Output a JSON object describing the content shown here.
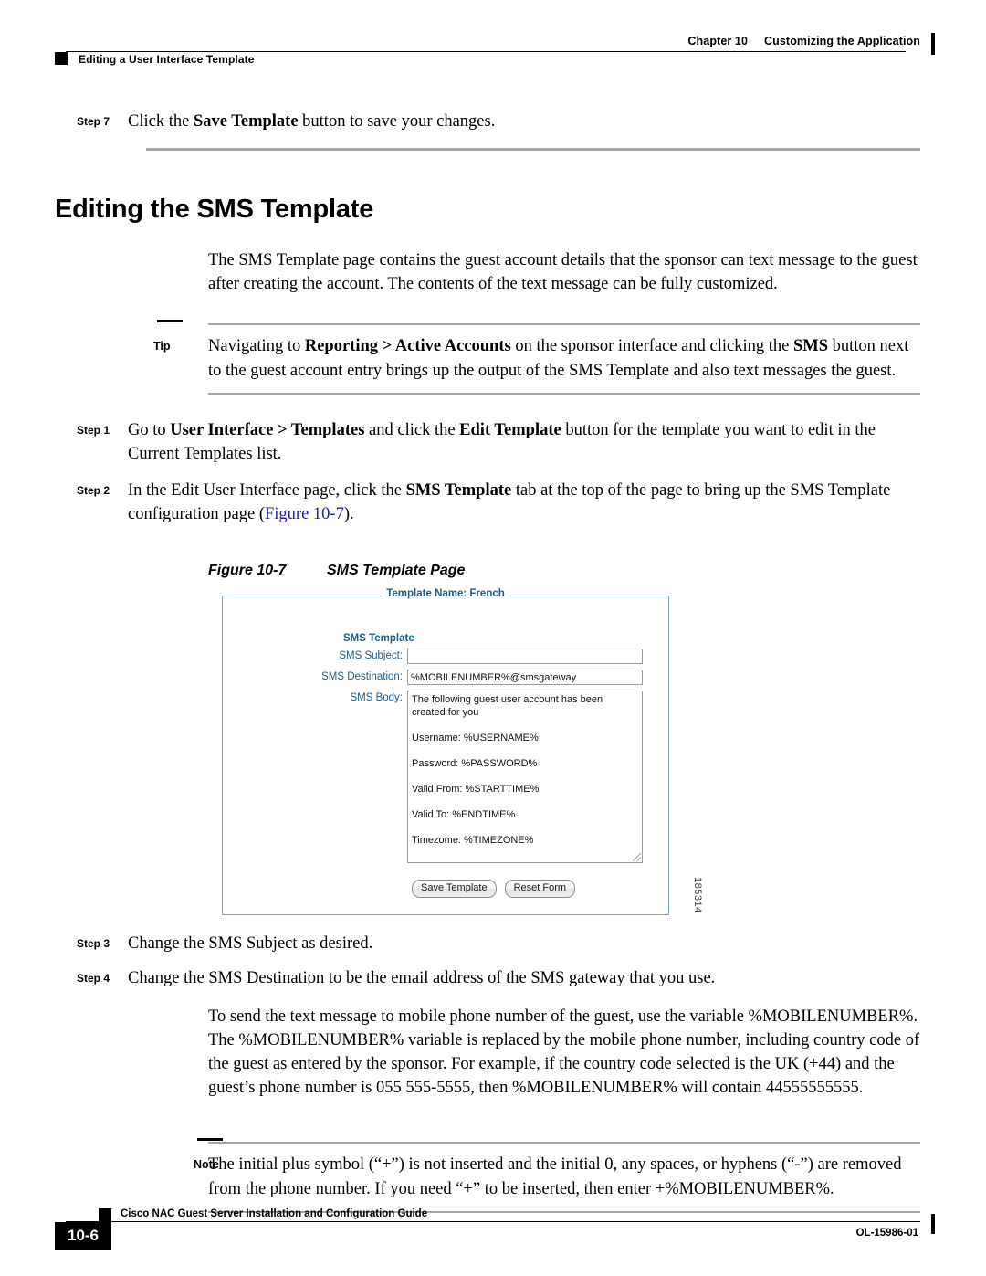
{
  "header": {
    "chapter_number": "Chapter 10",
    "chapter_title": "Customizing the Application",
    "section_title": "Editing a User Interface Template"
  },
  "steps_top": [
    {
      "label": "Step 7",
      "text_html": "Click the <b>Save Template</b> button to save your changes."
    }
  ],
  "section": {
    "title": "Editing the SMS Template",
    "intro": "The SMS Template page contains the guest account details that the sponsor can text message to the guest after creating the account. The contents of the text message can be fully customized."
  },
  "tip": {
    "label": "Tip",
    "text_html": "Navigating to <b>Reporting &gt; Active Accounts</b> on the sponsor interface and clicking the <b>SMS</b> button next to the guest account entry brings up the output of the SMS Template and also text messages the guest."
  },
  "steps_mid": [
    {
      "label": "Step 1",
      "text_html": "Go to <b>User Interface &gt; Templates</b> and click the <b>Edit Template</b> button for the template you want to edit in the Current Templates list."
    },
    {
      "label": "Step 2",
      "text_html": "In the Edit User Interface page, click the <b>SMS Template</b> tab at the top of the page to bring up the SMS Template configuration page (<span class=\"link\">Figure 10-7</span>)."
    }
  ],
  "figure": {
    "number": "Figure 10-7",
    "title": "SMS Template Page",
    "artwork_id": "185314",
    "screenshot": {
      "legend": "Template Name: French",
      "group_heading": "SMS Template",
      "fields": [
        {
          "label": "SMS Subject:",
          "value": "",
          "type": "text"
        },
        {
          "label": "SMS Destination:",
          "value": "%MOBILENUMBER%@smsgateway",
          "type": "text"
        },
        {
          "label": "SMS Body:",
          "value": "The following guest user account has been created for you\n\nUsername: %USERNAME%\n\nPassword: %PASSWORD%\n\nValid From: %STARTTIME%\n\nValid To: %ENDTIME%\n\nTimezome: %TIMEZONE%\n",
          "type": "textarea"
        }
      ],
      "buttons": [
        {
          "label": "Save Template"
        },
        {
          "label": "Reset Form"
        }
      ],
      "colors": {
        "label_blue": "#1d5e8c",
        "border_blue": "#7aa5c4"
      }
    }
  },
  "steps_bottom": [
    {
      "label": "Step 3",
      "text_html": "Change the SMS Subject as desired."
    },
    {
      "label": "Step 4",
      "text_html": "Change the SMS Destination to be the email address of the SMS gateway that you use."
    }
  ],
  "paragraph_after_steps": "To send the text message to mobile phone number of the guest, use the variable %MOBILENUMBER%. The %MOBILENUMBER% variable is replaced by the mobile phone number, including country code of the guest as entered by the sponsor. For example, if the country code selected is the UK (+44) and the guest’s phone number is 055 555-5555, then %MOBILENUMBER% will contain 44555555555.",
  "note": {
    "label": "Note",
    "text": "The initial plus symbol (“+”) is not inserted and the initial 0, any spaces, or hyphens (“-”) are removed from the phone number. If you need “+” to be inserted, then enter +%MOBILENUMBER%."
  },
  "footer": {
    "guide_title": "Cisco NAC Guest Server Installation and Configuration Guide",
    "page_number": "10-6",
    "doc_id": "OL-15986-01"
  }
}
